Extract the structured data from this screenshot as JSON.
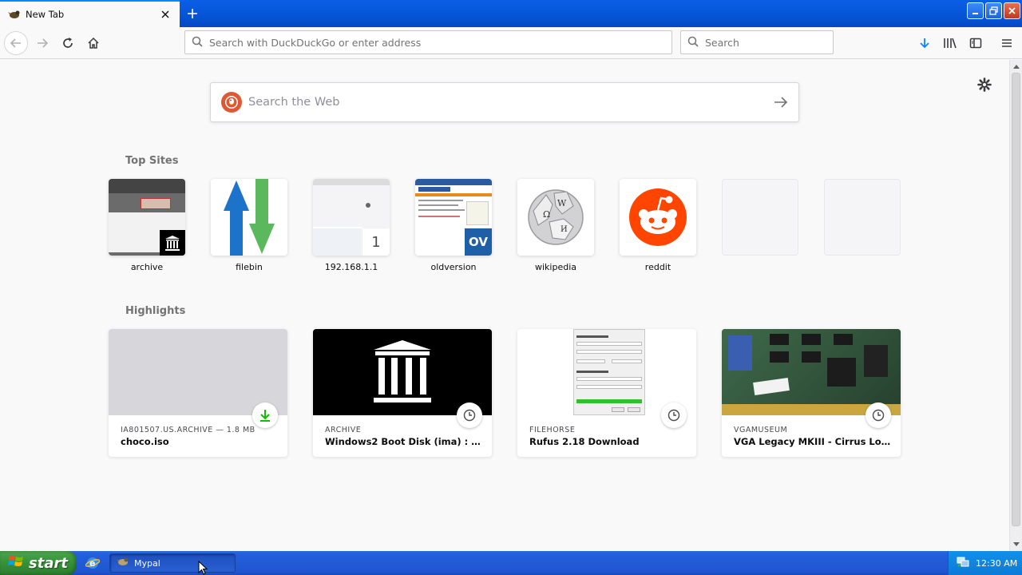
{
  "window": {
    "tab_title": "New Tab"
  },
  "toolbar": {
    "url_placeholder": "Search with DuckDuckGo or enter address",
    "search_placeholder": "Search"
  },
  "newtab": {
    "search_placeholder": "Search the Web",
    "top_sites_title": "Top Sites",
    "highlights_title": "Highlights",
    "top_sites": [
      {
        "label": "archive"
      },
      {
        "label": "filebin"
      },
      {
        "label": "192.168.1.1",
        "badge": "1"
      },
      {
        "label": "oldversion",
        "badge": "OV"
      },
      {
        "label": "wikipedia"
      },
      {
        "label": "reddit"
      },
      {
        "label": ""
      },
      {
        "label": ""
      }
    ],
    "highlights": [
      {
        "host": "IA801507.US.ARCHIVE — 1.8 MB",
        "title": "choco.iso",
        "badge_icon": "download-icon"
      },
      {
        "host": "ARCHIVE",
        "title": "Windows2 Boot Disk (ima) : Mic...",
        "badge_icon": "clock-icon"
      },
      {
        "host": "FILEHORSE",
        "title": "Rufus 2.18 Download",
        "badge_icon": "clock-icon"
      },
      {
        "host": "VGAMUSEUM",
        "title": "VGA Legacy MKIII - Cirrus Logic ...",
        "badge_icon": "clock-icon"
      }
    ]
  },
  "taskbar": {
    "start_label": "start",
    "task_label": "Mypal",
    "clock": "12:30 AM"
  },
  "colors": {
    "accent": "#0a84ff",
    "reddit": "#ff4500",
    "duckduckgo": "#de5833",
    "filebin_up": "#1d72c9",
    "filebin_down": "#5cb85c"
  }
}
